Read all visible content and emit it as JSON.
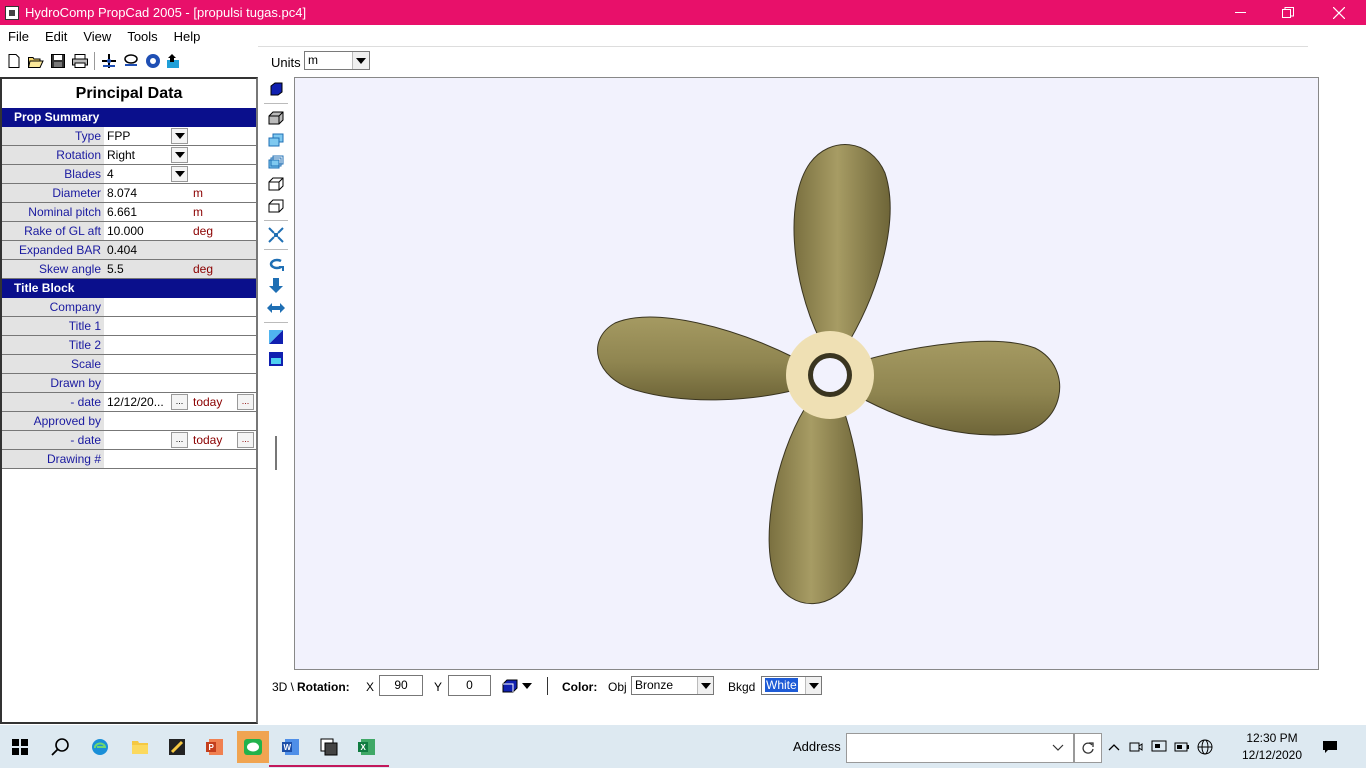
{
  "window": {
    "title": "HydroComp PropCad 2005 - [propulsi tugas.pc4]"
  },
  "menu": {
    "items": [
      "File",
      "Edit",
      "View",
      "Tools",
      "Help"
    ]
  },
  "units": {
    "label": "Units",
    "value": "m"
  },
  "panel": {
    "title": "Principal Data",
    "prop_summary": {
      "header": "Prop Summary",
      "rows": [
        {
          "label": "Type",
          "value": "FPP",
          "unit": ""
        },
        {
          "label": "Rotation",
          "value": "Right",
          "unit": ""
        },
        {
          "label": "Blades",
          "value": "4",
          "unit": ""
        },
        {
          "label": "Diameter",
          "value": "8.074",
          "unit": "m"
        },
        {
          "label": "Nominal pitch",
          "value": "6.661",
          "unit": "m"
        },
        {
          "label": "Rake of GL aft",
          "value": "10.000",
          "unit": "deg"
        },
        {
          "label": "Expanded BAR",
          "value": "0.404",
          "unit": ""
        },
        {
          "label": "Skew angle",
          "value": "5.5",
          "unit": "deg"
        }
      ]
    },
    "title_block": {
      "header": "Title Block",
      "rows": [
        {
          "label": "Company",
          "value": "",
          "unit": ""
        },
        {
          "label": "Title 1",
          "value": "",
          "unit": ""
        },
        {
          "label": "Title 2",
          "value": "",
          "unit": ""
        },
        {
          "label": "Scale",
          "value": "",
          "unit": ""
        },
        {
          "label": "Drawn by",
          "value": "",
          "unit": ""
        },
        {
          "label": "- date",
          "value": "12/12/20...",
          "unit": "today"
        },
        {
          "label": "Approved by",
          "value": "",
          "unit": ""
        },
        {
          "label": "- date",
          "value": "",
          "unit": "today"
        },
        {
          "label": "Drawing #",
          "value": "",
          "unit": ""
        }
      ]
    }
  },
  "bottom": {
    "tab": "3D \\",
    "rotation_label": "Rotation:",
    "x_label": "X",
    "x_value": "90",
    "y_label": "Y",
    "y_value": "0",
    "color_label": "Color:",
    "obj_label": "Obj",
    "obj_value": "Bronze",
    "bkgd_label": "Bkgd",
    "bkgd_value": "White"
  },
  "taskbar": {
    "address_label": "Address",
    "time": "12:30 PM",
    "date": "12/12/2020"
  },
  "colors": {
    "titlebar": "#e8106a",
    "section_header": "#0a0f8c",
    "canvas_bg": "#f2f2fd",
    "blade": "#8f8550",
    "hub": "#efe0b4"
  }
}
